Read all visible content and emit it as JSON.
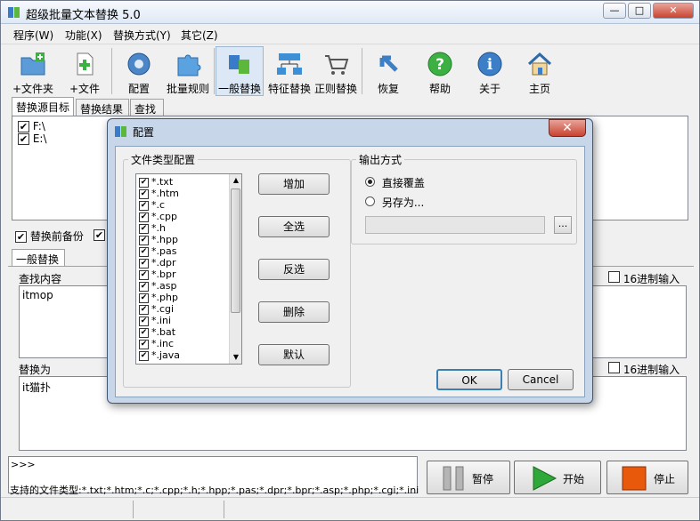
{
  "window": {
    "title": "超级批量文本替换 5.0"
  },
  "menu": [
    "程序(W)",
    "功能(X)",
    "替换方式(Y)",
    "其它(Z)"
  ],
  "toolbar": [
    {
      "label": "+文件夹",
      "icon": "add-folder-icon"
    },
    {
      "label": "+文件",
      "icon": "add-file-icon"
    },
    {
      "label": "配置",
      "icon": "config-icon"
    },
    {
      "label": "批量规则",
      "icon": "batch-rule-icon"
    },
    {
      "label": "一般替换",
      "icon": "normal-replace-icon"
    },
    {
      "label": "特征替换",
      "icon": "feature-replace-icon"
    },
    {
      "label": "正则替换",
      "icon": "regex-replace-icon"
    },
    {
      "label": "恢复",
      "icon": "restore-icon"
    },
    {
      "label": "帮助",
      "icon": "help-icon"
    },
    {
      "label": "关于",
      "icon": "about-icon"
    },
    {
      "label": "主页",
      "icon": "home-icon"
    }
  ],
  "source_tabs": [
    "替换源目标",
    "替换结果",
    "查找"
  ],
  "source_items": [
    "F:\\",
    "E:\\"
  ],
  "backup_label": "替换前备份",
  "replace_tab": "一般替换",
  "find": {
    "label": "查找内容",
    "value": "itmop",
    "hex_label": "16进制输入"
  },
  "replace": {
    "label": "替换为",
    "value": "it猫扑",
    "hex_label": "16进制输入"
  },
  "log_prompt": ">>>",
  "actions": {
    "pause": "暂停",
    "start": "开始",
    "stop": "停止"
  },
  "status_text": "支持的文件类型:*.txt;*.htm;*.c;*.cpp;*.h;*.hpp;*.pas;*.dpr;*.bpr;*.asp;*.php;*.cgi;*.ini;*.bat;*.inc;*.j",
  "dialog": {
    "title": "配置",
    "group_types": "文件类型配置",
    "file_types": [
      "*.txt",
      "*.htm",
      "*.c",
      "*.cpp",
      "*.h",
      "*.hpp",
      "*.pas",
      "*.dpr",
      "*.bpr",
      "*.asp",
      "*.php",
      "*.cgi",
      "*.ini",
      "*.bat",
      "*.inc",
      "*.java"
    ],
    "buttons": {
      "add": "增加",
      "select_all": "全选",
      "invert": "反选",
      "delete": "删除",
      "default": "默认"
    },
    "group_output": "输出方式",
    "radio_overwrite": "直接覆盖",
    "radio_save_as": "另存为...",
    "browse": "...",
    "ok": "OK",
    "cancel": "Cancel"
  },
  "colors": {
    "accent": "#3399ff",
    "start_green": "#2fa83a",
    "stop_orange": "#e8590c"
  }
}
